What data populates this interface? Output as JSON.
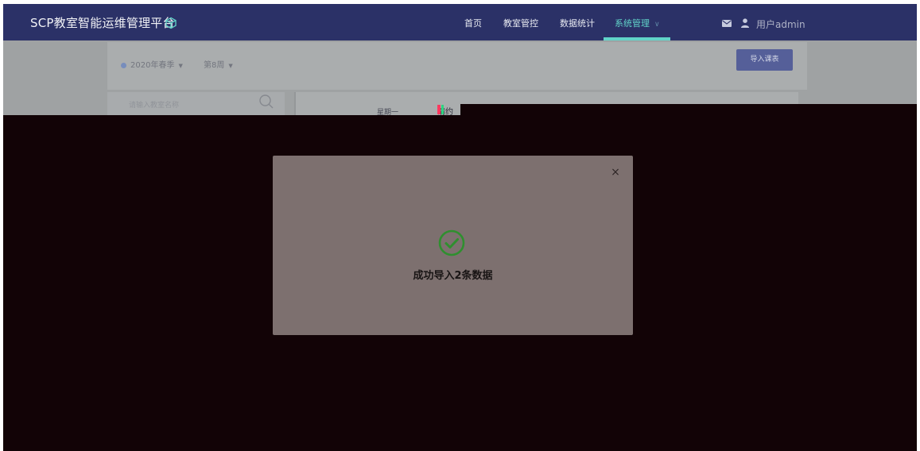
{
  "app": {
    "title": "SCP教室智能运维管理平台",
    "logo_icon": "cube-icon"
  },
  "nav": {
    "items": [
      {
        "label": "首页",
        "active": false
      },
      {
        "label": "教室管控",
        "active": false
      },
      {
        "label": "数据统计",
        "active": false
      },
      {
        "label": "系统管理",
        "active": true,
        "has_dropdown": true
      }
    ],
    "accent_color": "#61d3c8"
  },
  "user": {
    "mail_icon": "mail-icon",
    "user_icon": "user-icon",
    "name": "用户admin"
  },
  "toolbar": {
    "semester": "2020年春季",
    "week": "第8周",
    "import_label": "导入课表"
  },
  "search": {
    "placeholder": "请输入教室名称"
  },
  "schedule": {
    "weekday": "星期一",
    "glitched_text": "请约"
  },
  "dialog": {
    "close_glyph": "×",
    "icon": "check-circle-icon",
    "message": "成功导入2条数据"
  }
}
